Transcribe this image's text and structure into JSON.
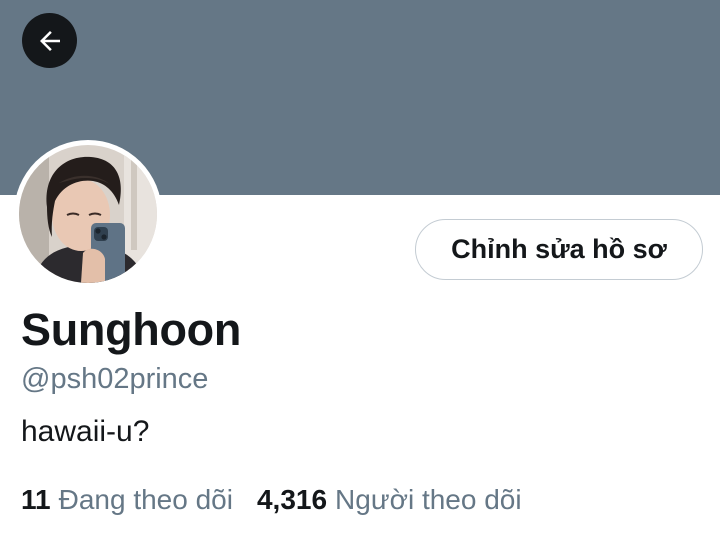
{
  "header": {
    "banner_color": "#657786",
    "back_icon": "arrow-left-icon"
  },
  "profile": {
    "display_name": "Sunghoon",
    "handle": "@psh02prince",
    "bio": "hawaii-u?",
    "edit_button_label": "Chỉnh sửa hồ sơ",
    "avatar_icon": "profile-photo"
  },
  "stats": {
    "following_count": "11",
    "following_label": "Đang theo dõi",
    "followers_count": "4,316",
    "followers_label": "Người theo dõi"
  }
}
